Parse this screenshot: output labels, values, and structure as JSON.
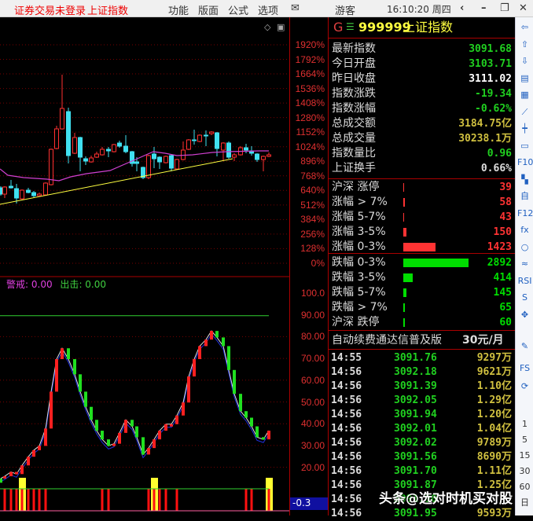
{
  "titlebar": {
    "status": "证券交易未登录",
    "index_name": "上证指数",
    "menu": [
      "功能",
      "版面",
      "公式",
      "选项"
    ],
    "mail_icon": "envelope-icon",
    "user": "游客",
    "clock": "16:10:20 周四",
    "buttons": [
      "‹",
      "–",
      "❐",
      "✕"
    ]
  },
  "chart": {
    "top_icons": [
      "◇",
      "▣"
    ],
    "price_axis": [
      "1920%",
      "1792%",
      "1664%",
      "1536%",
      "1408%",
      "1280%",
      "1152%",
      "1024%",
      "896%",
      "768%",
      "640%",
      "512%",
      "384%",
      "256%",
      "128%",
      "0%"
    ],
    "candles": [
      [
        1,
        239,
        247,
        237,
        249,
        "c"
      ],
      [
        6,
        247,
        238,
        237,
        252,
        "r"
      ],
      [
        14,
        239,
        237,
        229,
        240,
        "c"
      ],
      [
        21,
        240,
        252,
        234,
        259,
        "c"
      ],
      [
        28,
        253,
        242,
        241,
        254,
        "r"
      ],
      [
        36,
        242,
        245,
        239,
        246,
        "c"
      ],
      [
        43,
        245,
        249,
        243,
        251,
        "c"
      ],
      [
        50,
        249,
        247,
        245,
        250,
        "r"
      ],
      [
        58,
        248,
        233,
        232,
        249,
        "r"
      ],
      [
        65,
        235,
        190,
        189,
        236,
        "r"
      ],
      [
        72,
        189,
        164,
        160,
        190,
        "r"
      ],
      [
        79,
        164,
        138,
        95,
        165,
        "r"
      ],
      [
        87,
        142,
        198,
        137,
        208,
        "c"
      ],
      [
        95,
        195,
        175,
        169,
        196,
        "r"
      ],
      [
        102,
        175,
        200,
        174,
        218,
        "c"
      ],
      [
        109,
        202,
        205,
        199,
        210,
        "c"
      ],
      [
        116,
        206,
        201,
        198,
        207,
        "r"
      ],
      [
        123,
        200,
        196,
        193,
        201,
        "r"
      ],
      [
        130,
        197,
        190,
        187,
        198,
        "r"
      ],
      [
        138,
        190,
        192,
        187,
        200,
        "c"
      ],
      [
        145,
        193,
        184,
        183,
        194,
        "r"
      ],
      [
        152,
        182,
        186,
        179,
        188,
        "c"
      ],
      [
        160,
        186,
        193,
        172,
        195,
        "c"
      ],
      [
        168,
        193,
        208,
        192,
        212,
        "c"
      ],
      [
        174,
        206,
        208,
        200,
        218,
        "c"
      ],
      [
        182,
        213,
        226,
        212,
        228,
        "c"
      ],
      [
        189,
        226,
        198,
        197,
        228,
        "r"
      ],
      [
        196,
        196,
        202,
        187,
        214,
        "c"
      ],
      [
        203,
        200,
        206,
        199,
        215,
        "c"
      ],
      [
        211,
        207,
        199,
        198,
        208,
        "r"
      ],
      [
        218,
        198,
        214,
        196,
        218,
        "c"
      ],
      [
        225,
        215,
        203,
        202,
        216,
        "r"
      ],
      [
        233,
        203,
        191,
        180,
        204,
        "r"
      ],
      [
        240,
        190,
        178,
        177,
        191,
        "r"
      ],
      [
        247,
        178,
        179,
        165,
        184,
        "c"
      ],
      [
        254,
        180,
        172,
        171,
        181,
        "r"
      ],
      [
        262,
        172,
        173,
        166,
        186,
        "c"
      ],
      [
        269,
        170,
        168,
        167,
        172,
        "r"
      ],
      [
        276,
        169,
        189,
        168,
        199,
        "c"
      ],
      [
        284,
        191,
        182,
        181,
        205,
        "r"
      ],
      [
        291,
        182,
        200,
        180,
        202,
        "c"
      ],
      [
        298,
        200,
        197,
        195,
        205,
        "r"
      ],
      [
        306,
        197,
        188,
        186,
        198,
        "r"
      ],
      [
        313,
        188,
        191,
        183,
        195,
        "c"
      ],
      [
        320,
        192,
        195,
        186,
        198,
        "c"
      ],
      [
        327,
        196,
        203,
        195,
        206,
        "c"
      ],
      [
        335,
        203,
        199,
        198,
        218,
        "r"
      ],
      [
        342,
        199,
        197,
        194,
        200,
        "r"
      ]
    ],
    "ma": [
      [
        0,
        215
      ],
      [
        10,
        223
      ],
      [
        30,
        226
      ],
      [
        60,
        228
      ],
      [
        75,
        230
      ],
      [
        90,
        225
      ],
      [
        110,
        221
      ],
      [
        140,
        217
      ],
      [
        170,
        204
      ],
      [
        195,
        193
      ],
      [
        210,
        195
      ],
      [
        225,
        198
      ],
      [
        245,
        197
      ],
      [
        270,
        194
      ],
      [
        290,
        193
      ],
      [
        330,
        192
      ],
      [
        342,
        192
      ]
    ],
    "indicator_legend": {
      "warn_label": "警戒",
      "warn_value": ": 0.00",
      "strike_label": "出击",
      "strike_value": ": 0.00"
    },
    "indicator_axis": [
      "100.0",
      "90.00",
      "80.00",
      "70.00",
      "60.00",
      "50.00",
      "40.00",
      "30.00",
      "20.00"
    ],
    "indicator_values": [
      15,
      16,
      18,
      17,
      21,
      25,
      28,
      30,
      38,
      55,
      70,
      75,
      70,
      63,
      55,
      48,
      42,
      37,
      33,
      30,
      31,
      36,
      42,
      39,
      34,
      26,
      29,
      33,
      37,
      40,
      40,
      44,
      50,
      62,
      70,
      76,
      79,
      83,
      80,
      76,
      65,
      54,
      46,
      43,
      39,
      34,
      33,
      37
    ],
    "indicator_colors": "gr r r r r r r r r r r r g g g g g g g g r r r g g g r r r r r r r r r r r r g g g g g g g g g r",
    "signal_red": [
      6,
      14,
      21,
      28,
      36,
      43,
      50,
      58,
      130,
      138,
      189,
      196,
      203,
      211,
      225,
      313,
      320,
      342
    ],
    "signal_yellow": [
      28,
      196,
      342
    ],
    "cursor_value": "-0.3"
  },
  "quote": {
    "market_icon": "G",
    "menu_icon": "☰",
    "code": "999999",
    "name": "上证指数",
    "fields": [
      {
        "label": "最新指数",
        "value": "3091.68",
        "color": "#20d020"
      },
      {
        "label": "今日开盘",
        "value": "3103.71",
        "color": "#20d020"
      },
      {
        "label": "昨日收盘",
        "value": "3111.02",
        "color": "#ffffff"
      },
      {
        "label": "指数涨跌",
        "value": "-19.34",
        "color": "#20d020"
      },
      {
        "label": "指数涨幅",
        "value": "-0.62%",
        "color": "#20d020"
      },
      {
        "label": "总成交额",
        "value": "3184.75亿",
        "color": "#d0c040"
      },
      {
        "label": "总成交量",
        "value": "30238.1万",
        "color": "#d0c040"
      },
      {
        "label": "指数量比",
        "value": "0.96",
        "color": "#20d020"
      },
      {
        "label": "上证换手",
        "value": "0.66%",
        "color": "#dddddd"
      }
    ]
  },
  "breadth_up": [
    {
      "label": "沪深 涨停",
      "value": "39"
    },
    {
      "label": "涨幅 > 7%",
      "value": "58"
    },
    {
      "label": "涨幅 5-7%",
      "value": "43"
    },
    {
      "label": "涨幅 3-5%",
      "value": "150"
    },
    {
      "label": "涨幅 0-3%",
      "value": "1423"
    }
  ],
  "breadth_down": [
    {
      "label": "跌幅 0-3%",
      "value": "2892"
    },
    {
      "label": "跌幅 3-5%",
      "value": "414"
    },
    {
      "label": "跌幅 5-7%",
      "value": "145"
    },
    {
      "label": "跌幅 > 7%",
      "value": "65"
    },
    {
      "label": "沪深 跌停",
      "value": "60"
    }
  ],
  "colors": {
    "up": "#ff3333",
    "down": "#00dd00"
  },
  "ad": {
    "text": "自动续费通达信普及版",
    "price": "30元/月"
  },
  "ticks": [
    [
      "14:55",
      "3091.76",
      "9297万"
    ],
    [
      "14:56",
      "3092.18",
      "9621万"
    ],
    [
      "14:56",
      "3091.39",
      "1.10亿"
    ],
    [
      "14:56",
      "3092.05",
      "1.29亿"
    ],
    [
      "14:56",
      "3091.94",
      "1.20亿"
    ],
    [
      "14:56",
      "3092.01",
      "1.04亿"
    ],
    [
      "14:56",
      "3092.02",
      "9789万"
    ],
    [
      "14:56",
      "3091.56",
      "8690万"
    ],
    [
      "14:56",
      "3091.70",
      "1.11亿"
    ],
    [
      "14:56",
      "3091.87",
      "1.25亿"
    ],
    [
      "14:56",
      "3091.90",
      ""
    ],
    [
      "14:56",
      "3091.95",
      "9593万"
    ]
  ],
  "toolbar": {
    "icons": [
      "arrow-left-icon",
      "arrow-up-icon",
      "arrow-down-icon",
      "report-icon",
      "grid-icon",
      "line-chart-icon",
      "candle-icon",
      "window-icon",
      "f10-icon",
      "tree-icon",
      "self-select-icon",
      "f12-icon",
      "formula-icon",
      "circle-icon",
      "wave-icon",
      "rsi-icon",
      "s-icon",
      "move-icon",
      "pencil-icon",
      "fs-icon",
      "refresh-icon"
    ],
    "glyphs": [
      "⇦",
      "⇧",
      "⇩",
      "▤",
      "▦",
      "⟋",
      "┿",
      "▭",
      "F10",
      "▚",
      "自",
      "F12",
      "fx",
      "○",
      "≈",
      "RSI",
      "S",
      "✥",
      "✎",
      "FS",
      "⟳"
    ],
    "periods": [
      "1",
      "5",
      "15",
      "30",
      "60",
      "日"
    ]
  },
  "watermark": "头条@选对时机买对股"
}
